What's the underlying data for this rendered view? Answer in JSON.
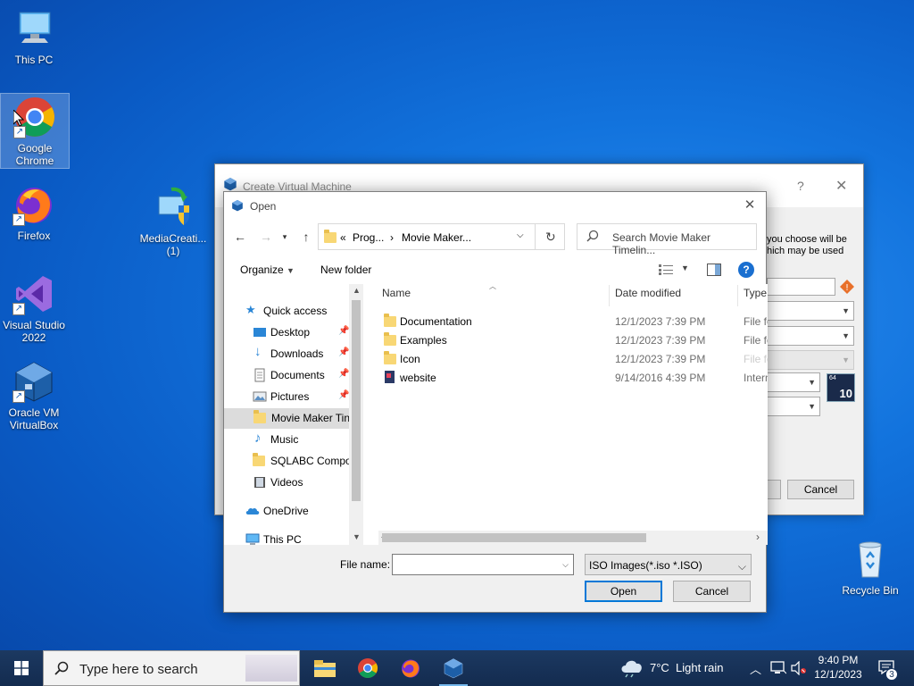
{
  "desktop": {
    "icons": [
      {
        "label": "This PC",
        "icon": "monitor-icon"
      },
      {
        "label": "Google Chrome",
        "icon": "chrome-icon"
      },
      {
        "label": "Firefox",
        "icon": "firefox-icon"
      },
      {
        "label": "Visual Studio 2022",
        "icon": "visual-studio-icon"
      },
      {
        "label": "Oracle VM VirtualBox",
        "icon": "virtualbox-icon"
      },
      {
        "label": "MediaCreati... (1)",
        "icon": "media-creation-tool-icon"
      },
      {
        "label": "Recycle Bin",
        "icon": "recycle-bin-icon"
      }
    ]
  },
  "back_window": {
    "title": "Create Virtual Machine",
    "help_glyph": "?",
    "close_glyph": "✕",
    "desc_line1": "you choose will be",
    "desc_line2": "hich may be used",
    "cancel_label": "Cancel",
    "os_badge": "10",
    "os_bits": "64"
  },
  "dialog": {
    "title": "Open",
    "address": {
      "prefix": "«",
      "crumb1": "Prog...",
      "separator": "›",
      "crumb2": "Movie Maker..."
    },
    "search_placeholder": "Search Movie Maker Timelin...",
    "toolbar": {
      "organize": "Organize",
      "new_folder": "New folder",
      "help_glyph": "?"
    },
    "sidebar": [
      {
        "label": "Quick access",
        "icon": "star-icon"
      },
      {
        "label": "Desktop",
        "icon": "desktop-folder-icon"
      },
      {
        "label": "Downloads",
        "icon": "download-icon"
      },
      {
        "label": "Documents",
        "icon": "documents-icon"
      },
      {
        "label": "Pictures",
        "icon": "pictures-icon"
      },
      {
        "label": "Movie Maker Tin",
        "icon": "folder-icon"
      },
      {
        "label": "Music",
        "icon": "music-icon"
      },
      {
        "label": "SQLABC Compo",
        "icon": "folder-icon"
      },
      {
        "label": "Videos",
        "icon": "videos-icon"
      },
      {
        "label": "OneDrive",
        "icon": "cloud-icon"
      },
      {
        "label": "This PC",
        "icon": "monitor-icon"
      }
    ],
    "columns": {
      "name": "Name",
      "date": "Date modified",
      "type": "Type"
    },
    "files": [
      {
        "name": "Documentation",
        "date": "12/1/2023 7:39 PM",
        "type": "File fo"
      },
      {
        "name": "Examples",
        "date": "12/1/2023 7:39 PM",
        "type": "File fo"
      },
      {
        "name": "Icon",
        "date": "12/1/2023 7:39 PM",
        "type": "File fo"
      },
      {
        "name": "website",
        "date": "9/14/2016 4:39 PM",
        "type": "Intern"
      }
    ],
    "file_name_label": "File name:",
    "file_name_value": "",
    "file_type": "ISO Images(*.iso *.ISO)",
    "open_label": "Open",
    "cancel_label": "Cancel"
  },
  "taskbar": {
    "search_placeholder": "Type here to search",
    "weather": "7°C  Light rain",
    "time": "9:40 PM",
    "date": "12/1/2023",
    "notification_count": "3"
  },
  "colors": {
    "accent": "#0078d7",
    "folder": "#f8d775",
    "taskbar": "#16325c"
  }
}
